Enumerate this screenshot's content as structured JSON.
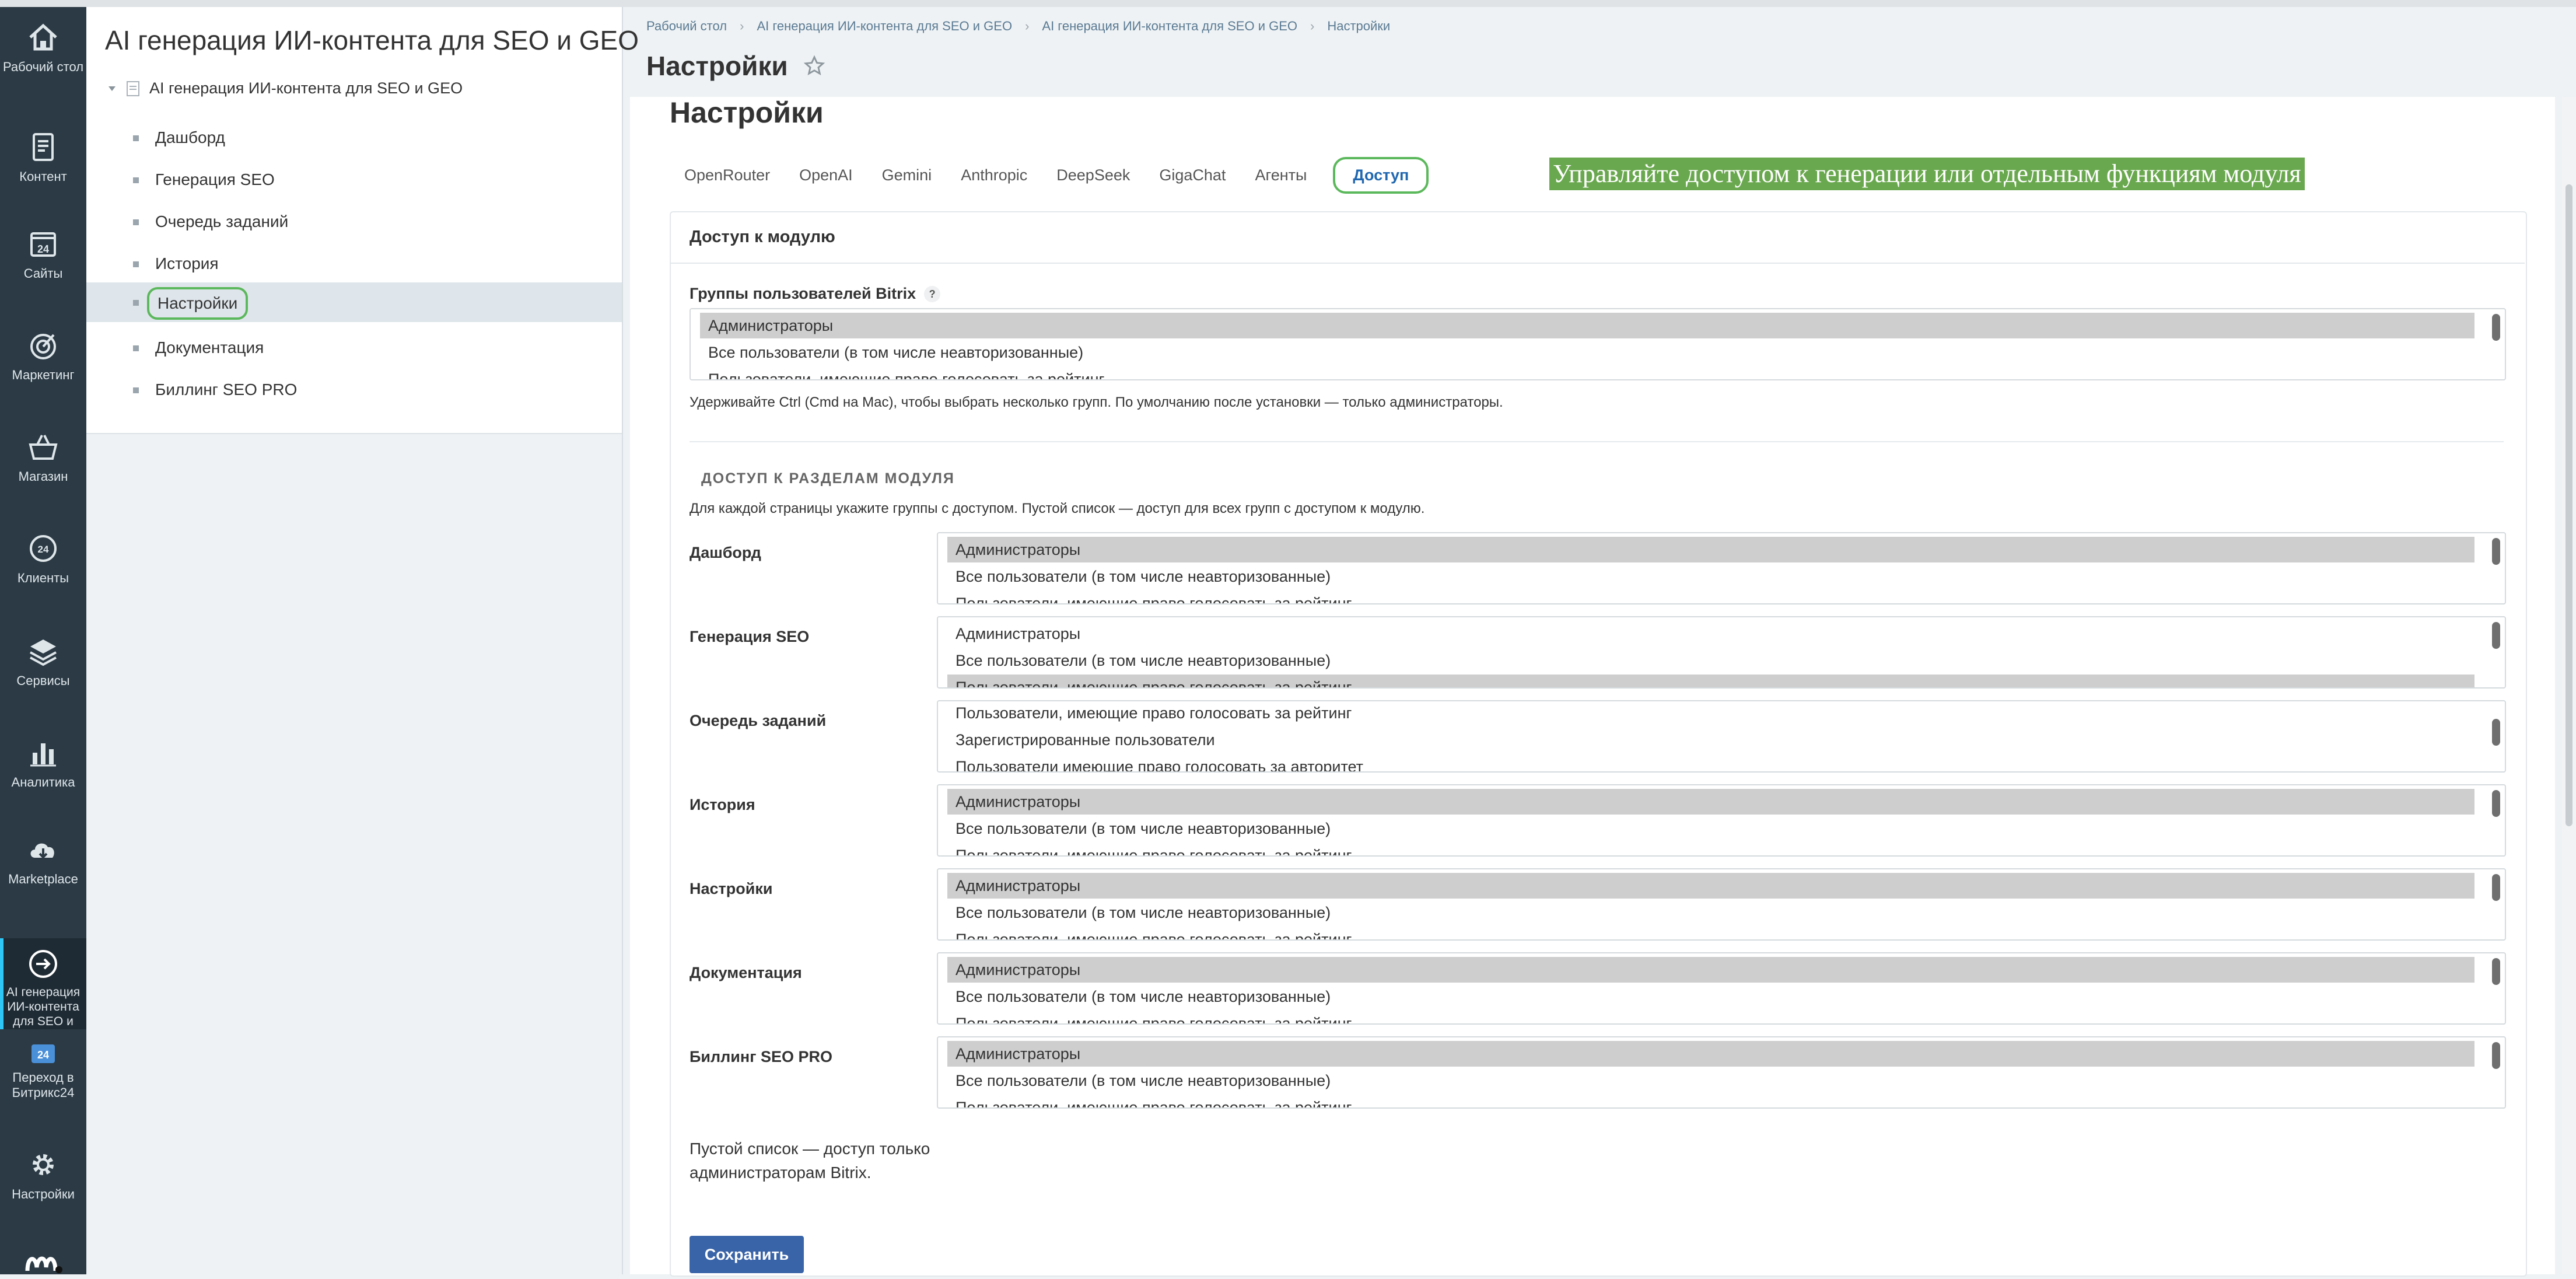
{
  "rail": [
    {
      "label": "Рабочий стол",
      "icon": "home-icon"
    },
    {
      "label": "Контент",
      "icon": "document-icon"
    },
    {
      "label": "Сайты",
      "icon": "calendar-24-icon"
    },
    {
      "label": "Маркетинг",
      "icon": "target-icon"
    },
    {
      "label": "Магазин",
      "icon": "basket-icon"
    },
    {
      "label": "Клиенты",
      "icon": "clients-24-icon"
    },
    {
      "label": "Сервисы",
      "icon": "layers-icon"
    },
    {
      "label": "Аналитика",
      "icon": "bar-chart-icon"
    },
    {
      "label": "Marketplace",
      "icon": "cloud-download-icon"
    },
    {
      "label": "AI генерация ИИ-контента для SEO и",
      "icon": "arrow-circle-icon"
    },
    {
      "label": "Переход в Битрикс24",
      "icon": "bitrix24-icon"
    },
    {
      "label": "Настройки",
      "icon": "gear-icon"
    }
  ],
  "tree": {
    "title": "AI генерация ИИ-контента для SEO и GEO",
    "root": "AI генерация ИИ-контента для SEO и GEO",
    "items": [
      "Дашборд",
      "Генерация SEO",
      "Очередь заданий",
      "История",
      "Настройки",
      "Документация",
      "Биллинг SEO PRO"
    ],
    "selected": "Настройки"
  },
  "breadcrumbs": [
    "Рабочий стол",
    "AI генерация ИИ-контента для SEO и GEO",
    "AI генерация ИИ-контента для SEO и GEO",
    "Настройки"
  ],
  "page_title": "Настройки",
  "content_title": "Настройки",
  "tabs": [
    "OpenRouter",
    "OpenAI",
    "Gemini",
    "Anthropic",
    "DeepSeek",
    "GigaChat",
    "Агенты",
    "Доступ"
  ],
  "active_tab": "Доступ",
  "hint_banner": "Управляйте доступом к генерации или отдельным функциям модуля",
  "section": {
    "title": "Доступ к модулю",
    "groups_label": "Группы пользователей Bitrix",
    "help_mark": "?",
    "groups_options": [
      {
        "text": "Администраторы",
        "selected": true
      },
      {
        "text": "Все пользователи (в том числе неавторизованные)",
        "selected": false
      },
      {
        "text": "Пользователи, имеющие право голосовать за рейтинг",
        "selected": false
      }
    ],
    "groups_help": "Удерживайте Ctrl (Cmd на Mac), чтобы выбрать несколько групп. По умолчанию после установки — только администраторы.",
    "sub_title": "ДОСТУП К РАЗДЕЛАМ МОДУЛЯ",
    "sub_help": "Для каждой страницы укажите группы с доступом. Пустой список — доступ для всех групп с доступом к модулю."
  },
  "page_access": [
    {
      "label": "Дашборд",
      "options": [
        {
          "text": "Администраторы",
          "selected": true
        },
        {
          "text": "Все пользователи (в том числе неавторизованные)",
          "selected": false
        },
        {
          "text": "Пользователи, имеющие право голосовать за рейтинг",
          "selected": false
        }
      ]
    },
    {
      "label": "Генерация SEO",
      "options": [
        {
          "text": "Администраторы",
          "selected": false
        },
        {
          "text": "Все пользователи (в том числе неавторизованные)",
          "selected": false
        },
        {
          "text": "Пользователи, имеющие право голосовать за рейтинг",
          "selected": true
        }
      ]
    },
    {
      "label": "Очередь заданий",
      "options": [
        {
          "text": "Пользователи, имеющие право голосовать за рейтинг",
          "selected": false
        },
        {
          "text": "Зарегистрированные пользователи",
          "selected": false
        },
        {
          "text": "Пользователи имеющие право голосовать за авторитет",
          "selected": false
        }
      ]
    },
    {
      "label": "История",
      "options": [
        {
          "text": "Администраторы",
          "selected": true
        },
        {
          "text": "Все пользователи (в том числе неавторизованные)",
          "selected": false
        },
        {
          "text": "Пользователи, имеющие право голосовать за рейтинг",
          "selected": false
        }
      ]
    },
    {
      "label": "Настройки",
      "options": [
        {
          "text": "Администраторы",
          "selected": true
        },
        {
          "text": "Все пользователи (в том числе неавторизованные)",
          "selected": false
        },
        {
          "text": "Пользователи, имеющие право голосовать за рейтинг",
          "selected": false
        }
      ]
    },
    {
      "label": "Документация",
      "options": [
        {
          "text": "Администраторы",
          "selected": true
        },
        {
          "text": "Все пользователи (в том числе неавторизованные)",
          "selected": false
        },
        {
          "text": "Пользователи, имеющие право голосовать за рейтинг",
          "selected": false
        }
      ]
    },
    {
      "label": "Биллинг SEO PRO",
      "options": [
        {
          "text": "Администраторы",
          "selected": true
        },
        {
          "text": "Все пользователи (в том числе неавторизованные)",
          "selected": false
        },
        {
          "text": "Пользователи, имеющие право голосовать за рейтинг",
          "selected": false
        }
      ]
    }
  ],
  "note": "Пустой список — доступ только администраторам Bitrix.",
  "save_label": "Сохранить",
  "colors": {
    "rail": "#2b3a45",
    "accent": "#5cb85c",
    "banner": "#6aa84f",
    "primary": "#3a64a8"
  }
}
